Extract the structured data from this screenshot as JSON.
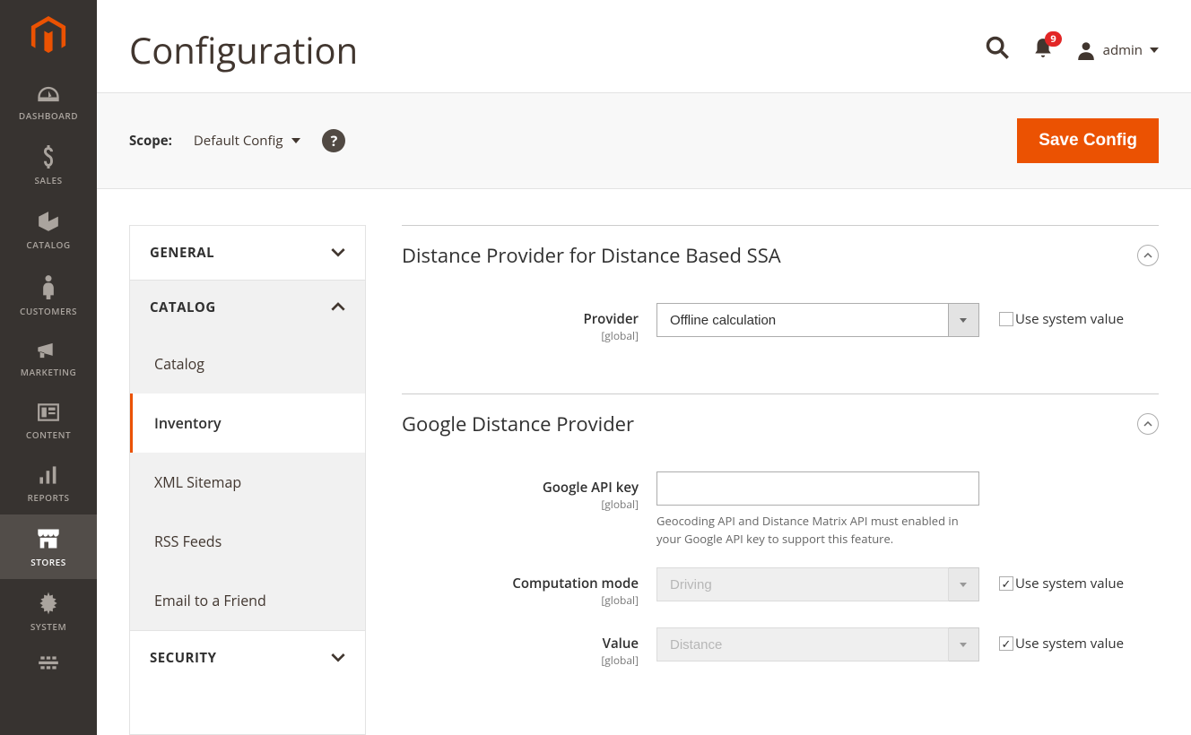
{
  "header": {
    "page_title": "Configuration",
    "notification_count": "9",
    "user_label": "admin"
  },
  "scope": {
    "label": "Scope:",
    "value": "Default Config",
    "save_button": "Save Config"
  },
  "sidebar": {
    "items": [
      {
        "label": "DASHBOARD"
      },
      {
        "label": "SALES"
      },
      {
        "label": "CATALOG"
      },
      {
        "label": "CUSTOMERS"
      },
      {
        "label": "MARKETING"
      },
      {
        "label": "CONTENT"
      },
      {
        "label": "REPORTS"
      },
      {
        "label": "STORES"
      },
      {
        "label": "SYSTEM"
      }
    ]
  },
  "config_nav": {
    "groups": [
      {
        "label": "GENERAL",
        "expanded": false
      },
      {
        "label": "CATALOG",
        "expanded": true,
        "items": [
          "Catalog",
          "Inventory",
          "XML Sitemap",
          "RSS Feeds",
          "Email to a Friend"
        ],
        "active_item": "Inventory"
      },
      {
        "label": "SECURITY",
        "expanded": false
      }
    ]
  },
  "fieldsets": {
    "distance_provider": {
      "title": "Distance Provider for Distance Based SSA",
      "fields": {
        "provider": {
          "label": "Provider",
          "scope": "[global]",
          "value": "Offline calculation",
          "use_system": false
        }
      }
    },
    "google_provider": {
      "title": "Google Distance Provider",
      "fields": {
        "api_key": {
          "label": "Google API key",
          "scope": "[global]",
          "value": "",
          "note": "Geocoding API and Distance Matrix API must enabled in your Google API key to support this feature."
        },
        "computation": {
          "label": "Computation mode",
          "scope": "[global]",
          "value": "Driving",
          "use_system": true
        },
        "value_field": {
          "label": "Value",
          "scope": "[global]",
          "value": "Distance",
          "use_system": true
        }
      }
    }
  },
  "use_system_label": "Use system value"
}
